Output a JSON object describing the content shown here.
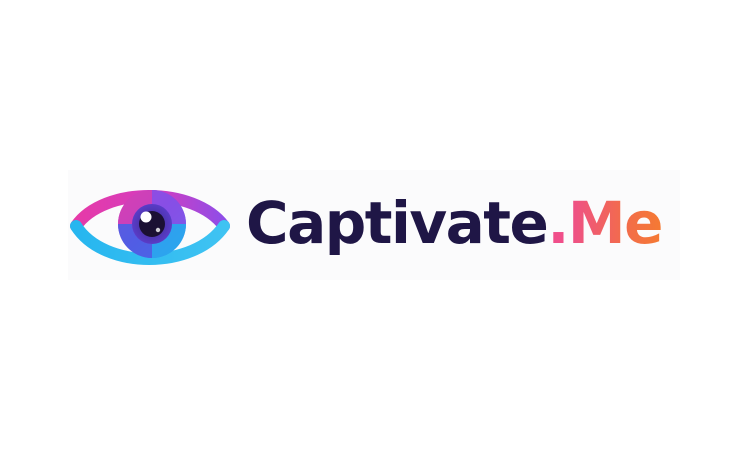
{
  "logo": {
    "wordmark_main": "Captivate",
    "wordmark_dot": ".",
    "wordmark_suffix": "Me",
    "icon": "eye-icon",
    "colors": {
      "navy": "#1f1646",
      "magenta": "#e63aa8",
      "purple": "#8e4de8",
      "cyan": "#2fb7ee",
      "pink": "#f04f8a",
      "orange": "#f57a32"
    }
  }
}
